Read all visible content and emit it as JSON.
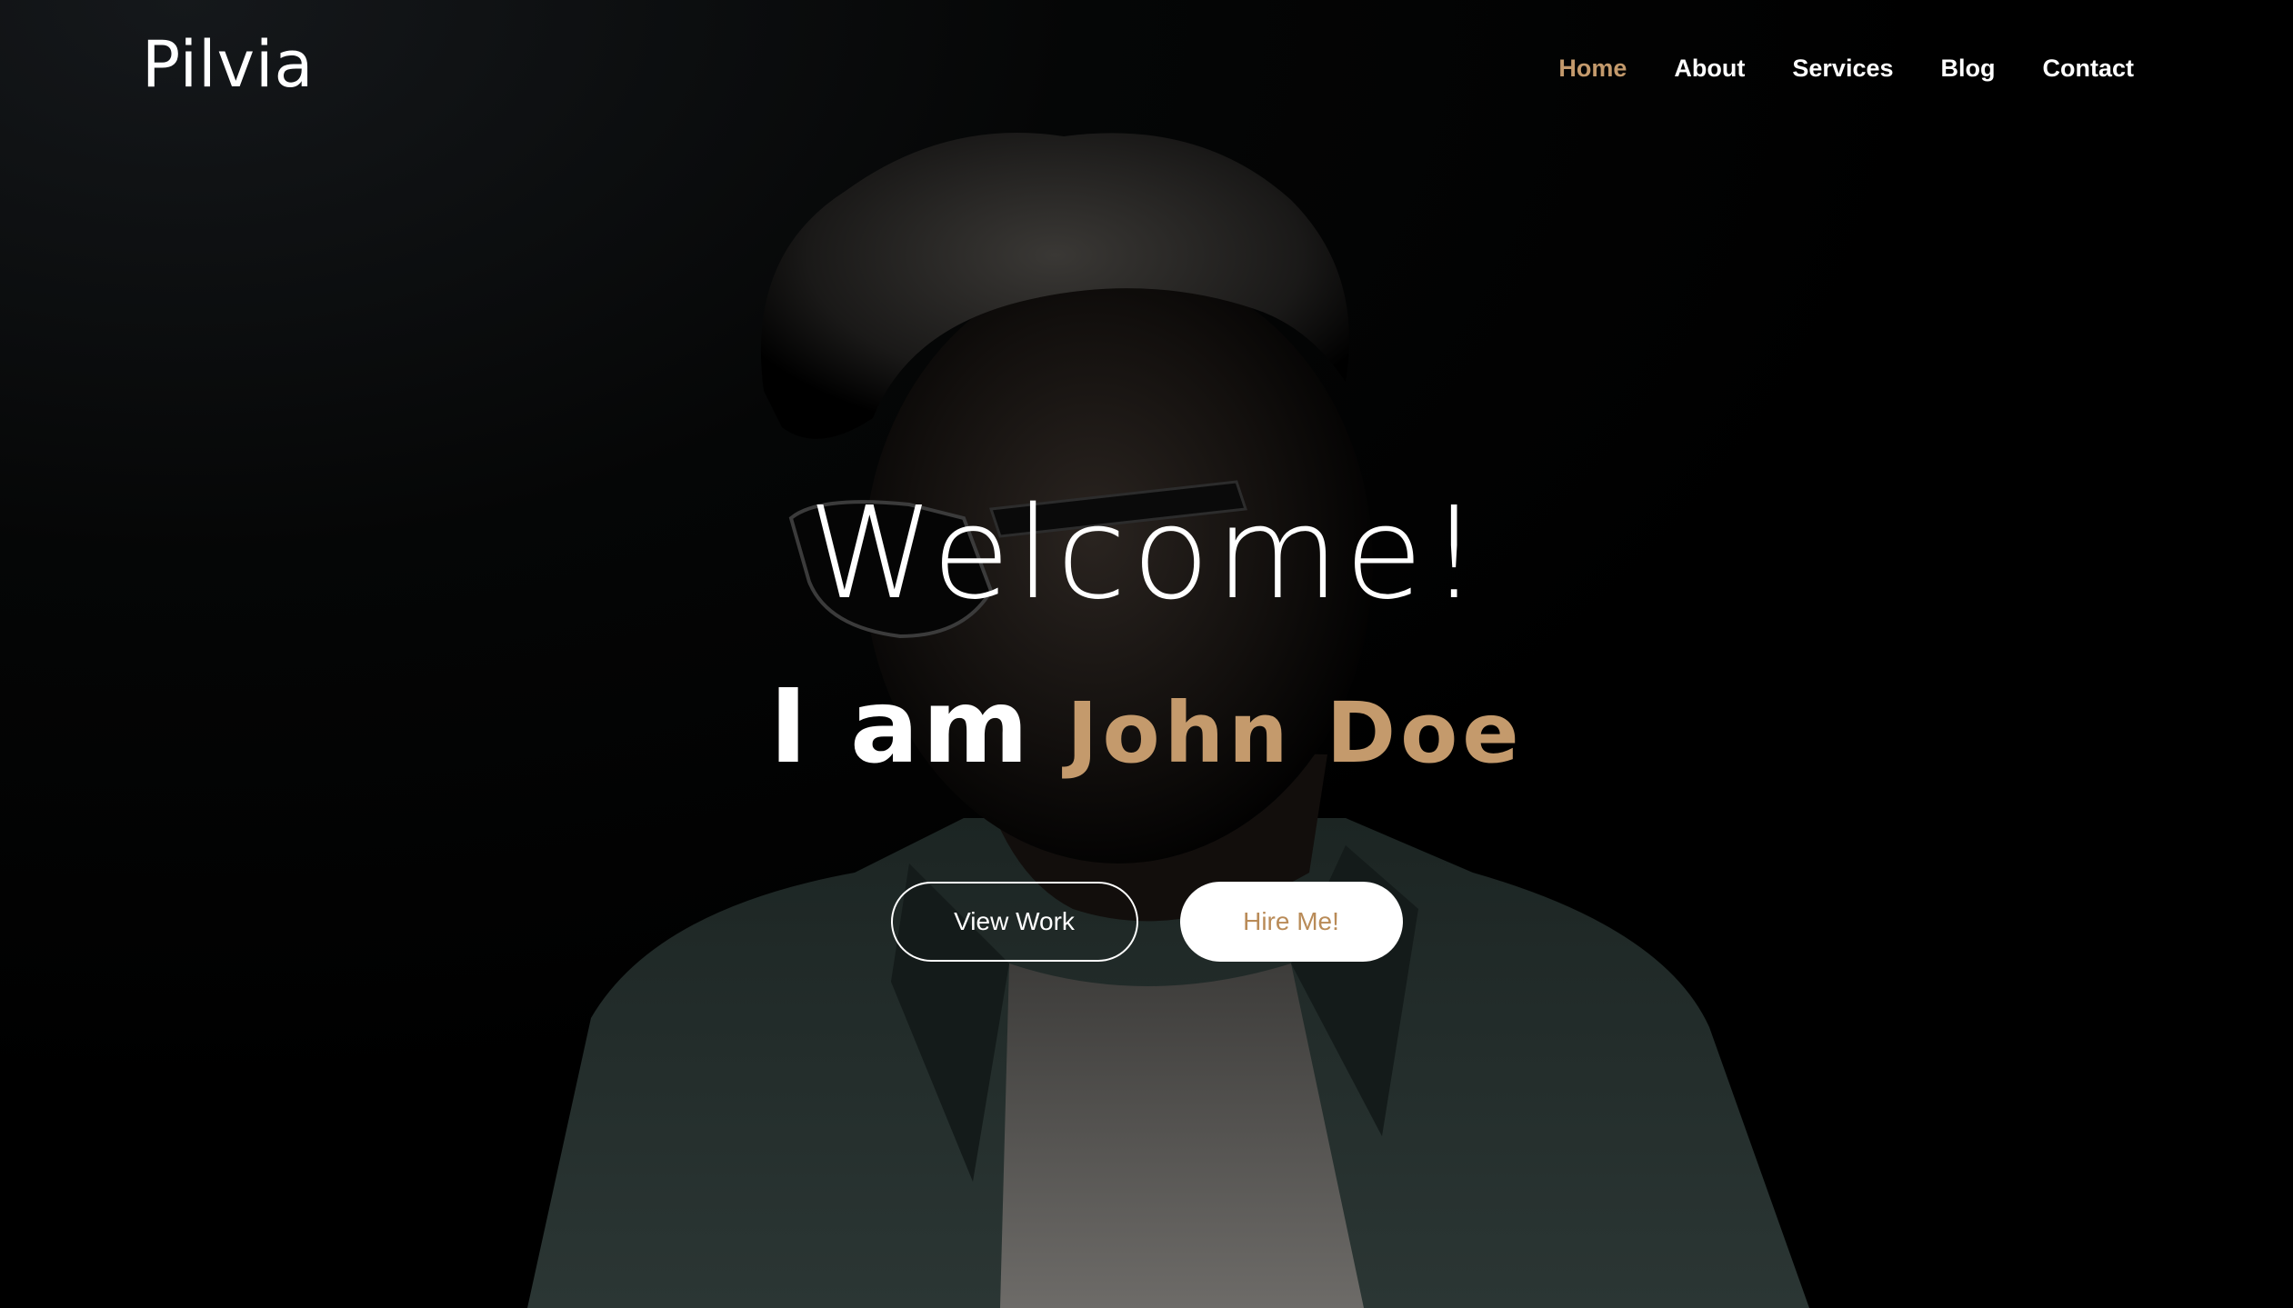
{
  "brand": {
    "logo_text": "Pilvia"
  },
  "nav": {
    "items": [
      {
        "label": "Home",
        "active": true
      },
      {
        "label": "About",
        "active": false
      },
      {
        "label": "Services",
        "active": false
      },
      {
        "label": "Blog",
        "active": false
      },
      {
        "label": "Contact",
        "active": false
      }
    ]
  },
  "hero": {
    "greeting": "Welcome!",
    "intro_lead": "I am",
    "intro_name": "John Doe",
    "primary_button": "View Work",
    "secondary_button": "Hire Me!",
    "background_image": "dark portrait of man with sunglasses and denim jacket"
  },
  "colors": {
    "accent": "#c49a6c",
    "background": "#000000",
    "text": "#ffffff"
  }
}
